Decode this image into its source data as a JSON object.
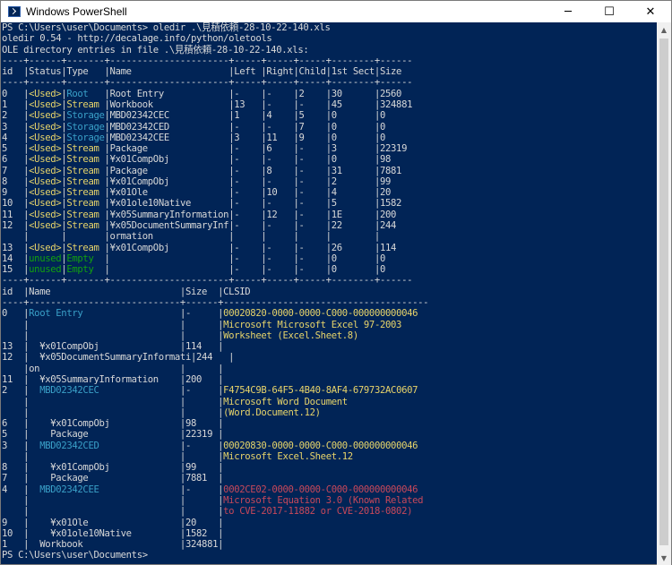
{
  "window": {
    "title": "Windows PowerShell",
    "minimize_glyph": "─",
    "maximize_glyph": "☐",
    "close_glyph": "✕"
  },
  "scrollbar": {
    "up_glyph": "▲",
    "down_glyph": "▼"
  },
  "colors": {
    "background": "#012456",
    "default": "#d8d8d8",
    "cyan": "#3aa0c8",
    "green": "#13a10e",
    "yellow": "#e8d46a",
    "red": "#c8485a"
  },
  "console": {
    "lines": [
      [
        {
          "c": "default",
          "t": "PS C:\\Users\\user\\Documents> oledir .\\見積依頼-28-10-22-140.xls"
        }
      ],
      [
        {
          "c": "default",
          "t": "oledir 0.54 - http://decalage.info/python/oletools"
        }
      ],
      [
        {
          "c": "default",
          "t": "OLE directory entries in file .\\見積依頼-28-10-22-140.xls:"
        }
      ],
      [
        {
          "c": "default",
          "t": "----+------+-------+----------------------+-----+-----+-----+--------+------"
        }
      ],
      [
        {
          "c": "default",
          "t": "id  |Status|Type   |Name                  |Left |Right|Child|1st Sect|Size"
        }
      ],
      [
        {
          "c": "default",
          "t": "----+------+-------+----------------------+-----+-----+-----+--------+------"
        }
      ],
      [
        {
          "c": "default",
          "t": "0   |"
        },
        {
          "c": "yellow",
          "t": "<Used>"
        },
        {
          "c": "default",
          "t": "|"
        },
        {
          "c": "cyan",
          "t": "Root   "
        },
        {
          "c": "default",
          "t": "|Root Entry            |-    |-    |2    |30      |2560"
        }
      ],
      [
        {
          "c": "default",
          "t": "1   |"
        },
        {
          "c": "yellow",
          "t": "<Used>"
        },
        {
          "c": "default",
          "t": "|"
        },
        {
          "c": "yellow",
          "t": "Stream "
        },
        {
          "c": "default",
          "t": "|Workbook              |13   |-    |-    |45      |324881"
        }
      ],
      [
        {
          "c": "default",
          "t": "2   |"
        },
        {
          "c": "yellow",
          "t": "<Used>"
        },
        {
          "c": "default",
          "t": "|"
        },
        {
          "c": "cyan",
          "t": "Storage"
        },
        {
          "c": "default",
          "t": "|MBD02342CEC           |1    |4    |5    |0       |0"
        }
      ],
      [
        {
          "c": "default",
          "t": "3   |"
        },
        {
          "c": "yellow",
          "t": "<Used>"
        },
        {
          "c": "default",
          "t": "|"
        },
        {
          "c": "cyan",
          "t": "Storage"
        },
        {
          "c": "default",
          "t": "|MBD02342CED           |-    |-    |7    |0       |0"
        }
      ],
      [
        {
          "c": "default",
          "t": "4   |"
        },
        {
          "c": "yellow",
          "t": "<Used>"
        },
        {
          "c": "default",
          "t": "|"
        },
        {
          "c": "cyan",
          "t": "Storage"
        },
        {
          "c": "default",
          "t": "|MBD02342CEE           |3    |11   |9    |0       |0"
        }
      ],
      [
        {
          "c": "default",
          "t": "5   |"
        },
        {
          "c": "yellow",
          "t": "<Used>"
        },
        {
          "c": "default",
          "t": "|"
        },
        {
          "c": "yellow",
          "t": "Stream "
        },
        {
          "c": "default",
          "t": "|Package               |-    |6    |-    |3       |22319"
        }
      ],
      [
        {
          "c": "default",
          "t": "6   |"
        },
        {
          "c": "yellow",
          "t": "<Used>"
        },
        {
          "c": "default",
          "t": "|"
        },
        {
          "c": "yellow",
          "t": "Stream "
        },
        {
          "c": "default",
          "t": "|¥x01CompObj           |-    |-    |-    |0       |98"
        }
      ],
      [
        {
          "c": "default",
          "t": "7   |"
        },
        {
          "c": "yellow",
          "t": "<Used>"
        },
        {
          "c": "default",
          "t": "|"
        },
        {
          "c": "yellow",
          "t": "Stream "
        },
        {
          "c": "default",
          "t": "|Package               |-    |8    |-    |31      |7881"
        }
      ],
      [
        {
          "c": "default",
          "t": "8   |"
        },
        {
          "c": "yellow",
          "t": "<Used>"
        },
        {
          "c": "default",
          "t": "|"
        },
        {
          "c": "yellow",
          "t": "Stream "
        },
        {
          "c": "default",
          "t": "|¥x01CompObj           |-    |-    |-    |2       |99"
        }
      ],
      [
        {
          "c": "default",
          "t": "9   |"
        },
        {
          "c": "yellow",
          "t": "<Used>"
        },
        {
          "c": "default",
          "t": "|"
        },
        {
          "c": "yellow",
          "t": "Stream "
        },
        {
          "c": "default",
          "t": "|¥x01Ole               |-    |10   |-    |4       |20"
        }
      ],
      [
        {
          "c": "default",
          "t": "10  |"
        },
        {
          "c": "yellow",
          "t": "<Used>"
        },
        {
          "c": "default",
          "t": "|"
        },
        {
          "c": "yellow",
          "t": "Stream "
        },
        {
          "c": "default",
          "t": "|¥x01ole10Native       |-    |-    |-    |5       |1582"
        }
      ],
      [
        {
          "c": "default",
          "t": "11  |"
        },
        {
          "c": "yellow",
          "t": "<Used>"
        },
        {
          "c": "default",
          "t": "|"
        },
        {
          "c": "yellow",
          "t": "Stream "
        },
        {
          "c": "default",
          "t": "|¥x05SummaryInformation|-    |12   |-    |1E      |200"
        }
      ],
      [
        {
          "c": "default",
          "t": "12  |"
        },
        {
          "c": "yellow",
          "t": "<Used>"
        },
        {
          "c": "default",
          "t": "|"
        },
        {
          "c": "yellow",
          "t": "Stream "
        },
        {
          "c": "default",
          "t": "|¥x05DocumentSummaryInf|-    |-    |-    |22      |244"
        }
      ],
      [
        {
          "c": "default",
          "t": "    |      |       |ormation              |     |     |     |        |"
        }
      ],
      [
        {
          "c": "default",
          "t": "13  |"
        },
        {
          "c": "yellow",
          "t": "<Used>"
        },
        {
          "c": "default",
          "t": "|"
        },
        {
          "c": "yellow",
          "t": "Stream "
        },
        {
          "c": "default",
          "t": "|¥x01CompObj           |-    |-    |-    |26      |114"
        }
      ],
      [
        {
          "c": "default",
          "t": "14  |"
        },
        {
          "c": "green",
          "t": "unused"
        },
        {
          "c": "default",
          "t": "|"
        },
        {
          "c": "green",
          "t": "Empty  "
        },
        {
          "c": "default",
          "t": "|                      |-    |-    |-    |0       |0"
        }
      ],
      [
        {
          "c": "default",
          "t": "15  |"
        },
        {
          "c": "green",
          "t": "unused"
        },
        {
          "c": "default",
          "t": "|"
        },
        {
          "c": "green",
          "t": "Empty  "
        },
        {
          "c": "default",
          "t": "|                      |-    |-    |-    |0       |0"
        }
      ],
      [
        {
          "c": "default",
          "t": "----+------+-------+----------------------+-----+-----+-----+--------+------"
        }
      ],
      [
        {
          "c": "default",
          "t": "id  |Name                        |Size  |CLSID"
        }
      ],
      [
        {
          "c": "default",
          "t": "----+----------------------------+------+--------------------------------------"
        }
      ],
      [
        {
          "c": "default",
          "t": "0   |"
        },
        {
          "c": "cyan",
          "t": "Root Entry                  "
        },
        {
          "c": "default",
          "t": "|-     |"
        },
        {
          "c": "yellow",
          "t": "00020820-0000-0000-C000-000000000046"
        }
      ],
      [
        {
          "c": "default",
          "t": "    |                            |      |"
        },
        {
          "c": "yellow",
          "t": "Microsoft Microsoft Excel 97-2003"
        }
      ],
      [
        {
          "c": "default",
          "t": "    |                            |      |"
        },
        {
          "c": "yellow",
          "t": "Worksheet (Excel.Sheet.8)"
        }
      ],
      [
        {
          "c": "default",
          "t": "13  |  ¥x01CompObj               |114   |"
        }
      ],
      [
        {
          "c": "default",
          "t": "12  |  ¥x05DocumentSummaryInformati|244   |"
        }
      ],
      [
        {
          "c": "default",
          "t": "    |on                          |      |"
        }
      ],
      [
        {
          "c": "default",
          "t": "11  |  ¥x05SummaryInformation    |200   |"
        }
      ],
      [
        {
          "c": "default",
          "t": "2   |  "
        },
        {
          "c": "cyan",
          "t": "MBD02342CEC               "
        },
        {
          "c": "default",
          "t": "|-     |"
        },
        {
          "c": "yellow",
          "t": "F4754C9B-64F5-4B40-8AF4-679732AC0607"
        }
      ],
      [
        {
          "c": "default",
          "t": "    |                            |      |"
        },
        {
          "c": "yellow",
          "t": "Microsoft Word Document"
        }
      ],
      [
        {
          "c": "default",
          "t": "    |                            |      |"
        },
        {
          "c": "yellow",
          "t": "(Word.Document.12)"
        }
      ],
      [
        {
          "c": "default",
          "t": "6   |    ¥x01CompObj             |98    |"
        }
      ],
      [
        {
          "c": "default",
          "t": "5   |    Package                 |22319 |"
        }
      ],
      [
        {
          "c": "default",
          "t": "3   |  "
        },
        {
          "c": "cyan",
          "t": "MBD02342CED               "
        },
        {
          "c": "default",
          "t": "|-     |"
        },
        {
          "c": "yellow",
          "t": "00020830-0000-0000-C000-000000000046"
        }
      ],
      [
        {
          "c": "default",
          "t": "    |                            |      |"
        },
        {
          "c": "yellow",
          "t": "Microsoft Excel.Sheet.12"
        }
      ],
      [
        {
          "c": "default",
          "t": "8   |    ¥x01CompObj             |99    |"
        }
      ],
      [
        {
          "c": "default",
          "t": "7   |    Package                 |7881  |"
        }
      ],
      [
        {
          "c": "default",
          "t": "4   |  "
        },
        {
          "c": "cyan",
          "t": "MBD02342CEE               "
        },
        {
          "c": "default",
          "t": "|-     |"
        },
        {
          "c": "red",
          "t": "0002CE02-0000-0000-C000-000000000046"
        }
      ],
      [
        {
          "c": "default",
          "t": "    |                            |      |"
        },
        {
          "c": "red",
          "t": "Microsoft Equation 3.0 (Known Related"
        }
      ],
      [
        {
          "c": "default",
          "t": "    |                            |      |"
        },
        {
          "c": "red",
          "t": "to CVE-2017-11882 or CVE-2018-0802)"
        }
      ],
      [
        {
          "c": "default",
          "t": "9   |    ¥x01Ole                 |20    |"
        }
      ],
      [
        {
          "c": "default",
          "t": "10  |    ¥x01ole10Native         |1582  |"
        }
      ],
      [
        {
          "c": "default",
          "t": "1   |  Workbook                  |324881|"
        }
      ],
      [
        {
          "c": "default",
          "t": "PS C:\\Users\\user\\Documents>"
        }
      ]
    ]
  }
}
